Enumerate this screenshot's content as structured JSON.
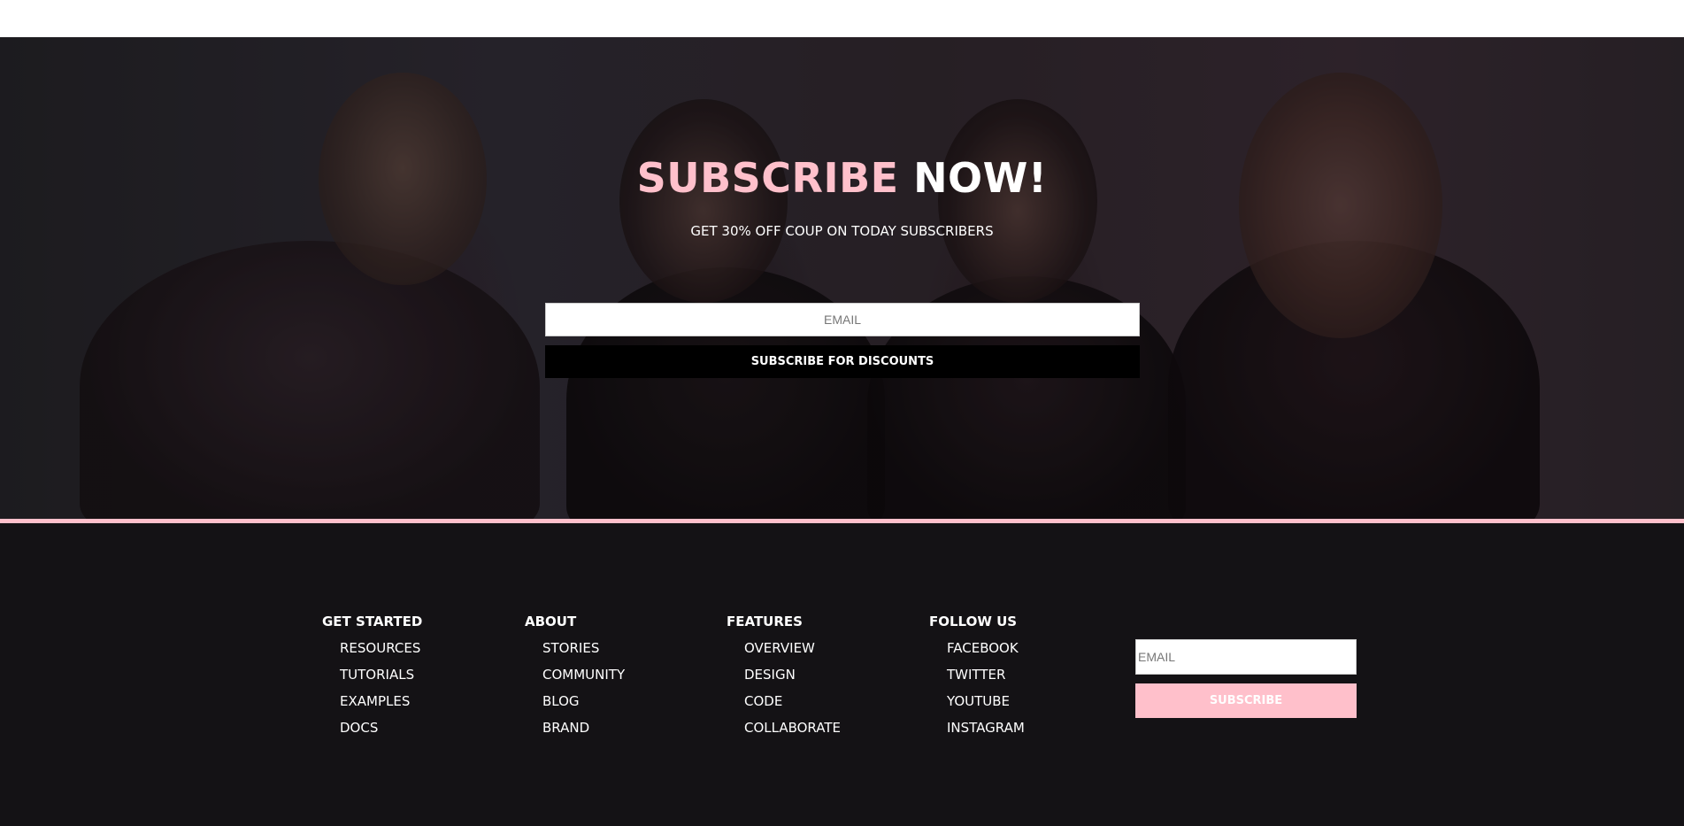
{
  "hero": {
    "title_part1": "SUBSCRIBE",
    "title_part2": "NOW!",
    "subtitle": "GET 30% OFF COUP ON TODAY SUBSCRIBERS",
    "email_placeholder": "EMAIL",
    "button_label": "SUBSCRIBE FOR DISCOUNTS"
  },
  "footer": {
    "columns": [
      {
        "heading": "GET STARTED",
        "items": [
          "RESOURCES",
          "TUTORIALS",
          "EXAMPLES",
          "DOCS"
        ]
      },
      {
        "heading": "ABOUT",
        "items": [
          "STORIES",
          "COMMUNITY",
          "BLOG",
          "BRAND"
        ]
      },
      {
        "heading": "FEATURES",
        "items": [
          "OVERVIEW",
          "DESIGN",
          "CODE",
          "COLLABORATE"
        ]
      },
      {
        "heading": "FOLLOW US",
        "items": [
          "FACEBOOK",
          "TWITTER",
          "YOUTUBE",
          "INSTAGRAM"
        ]
      }
    ],
    "email_placeholder": "EMAIL",
    "button_label": "SUBSCRIBE"
  },
  "colors": {
    "accent_pink": "#ffc0cb",
    "footer_bg": "#141215",
    "hero_button_bg": "#000000"
  }
}
